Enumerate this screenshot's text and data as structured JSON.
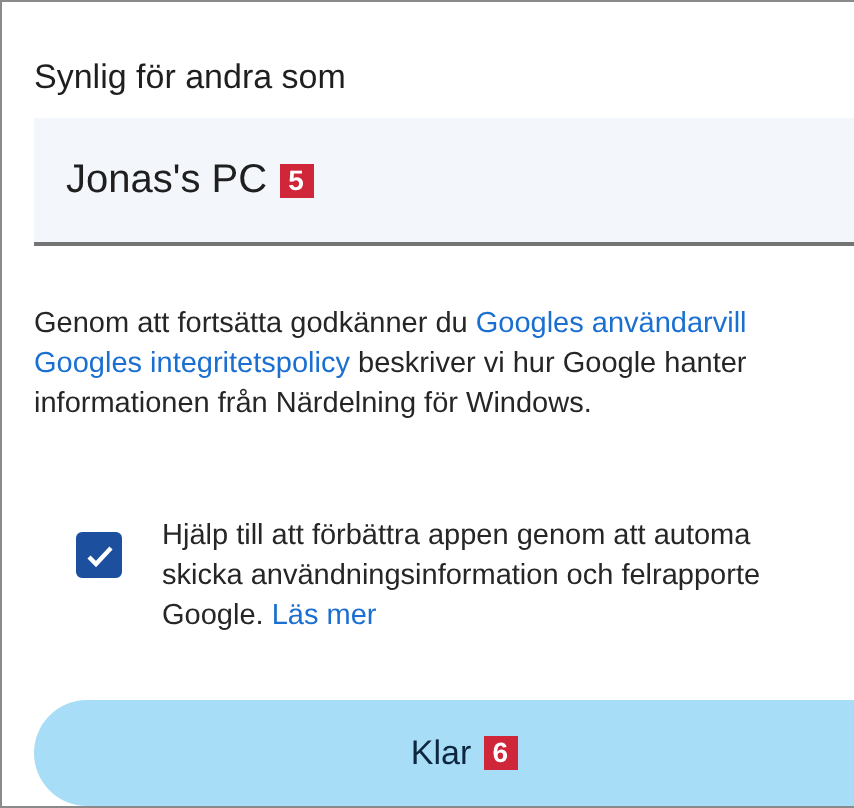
{
  "name_field": {
    "label": "Synlig för andra som",
    "value": "Jonas's PC",
    "badge": "5"
  },
  "terms": {
    "lines": [
      [
        {
          "text": "Genom att fortsätta godkänner du ",
          "link": false
        },
        {
          "text": "Googles användarvill",
          "link": true
        }
      ],
      [
        {
          "text": "Googles integritetspolicy",
          "link": true
        },
        {
          "text": " beskriver vi hur Google hanter",
          "link": false
        }
      ],
      [
        {
          "text": "informationen från Närdelning för Windows.",
          "link": false
        }
      ]
    ]
  },
  "consent": {
    "checked": true,
    "lines": [
      [
        {
          "text": "Hjälp till att förbättra appen genom att automa",
          "link": false
        }
      ],
      [
        {
          "text": "skicka användningsinformation och felrapporte",
          "link": false
        }
      ],
      [
        {
          "text": "Google. ",
          "link": false
        },
        {
          "text": "Läs mer",
          "link": true
        }
      ]
    ]
  },
  "done_button": {
    "label": "Klar",
    "badge": "6"
  }
}
